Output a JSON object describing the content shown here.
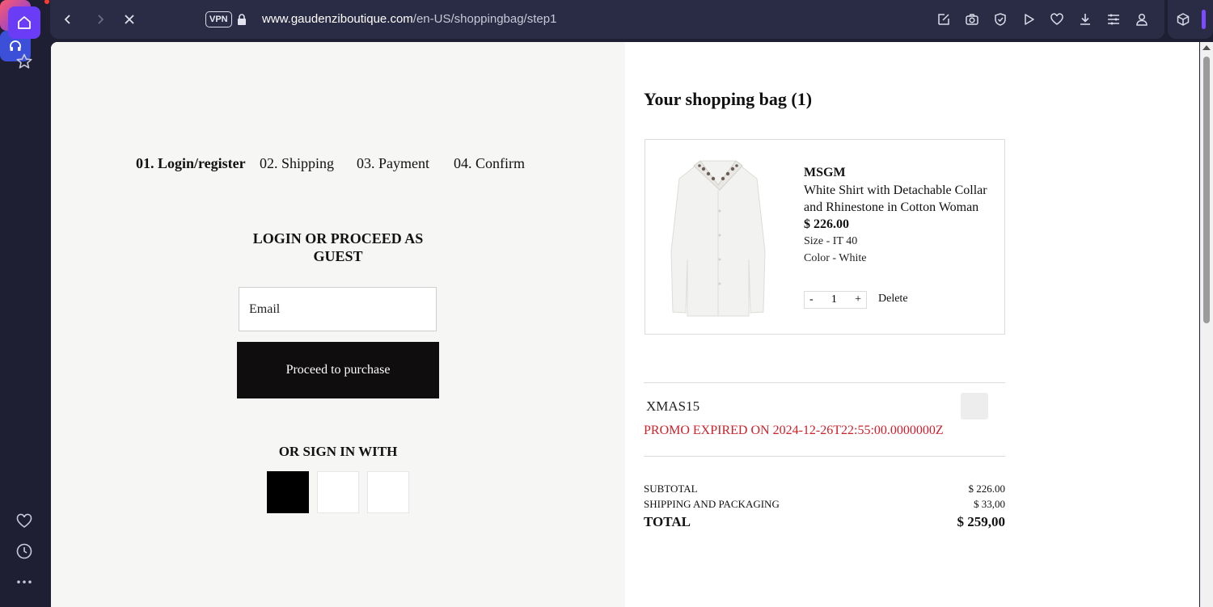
{
  "browser": {
    "vpn_label": "VPN",
    "url_host": "www.gaudenziboutique.com",
    "url_path": "/en-US/shoppingbag/step1"
  },
  "checkout": {
    "steps": [
      {
        "label": "01. Login/register",
        "active": true
      },
      {
        "label": "02. Shipping",
        "active": false
      },
      {
        "label": "03. Payment",
        "active": false
      },
      {
        "label": "04. Confirm",
        "active": false
      }
    ],
    "login_title": "LOGIN OR PROCEED AS GUEST",
    "email_placeholder": "Email",
    "proceed_label": "Proceed to purchase",
    "or_sign_in": "OR SIGN IN WITH"
  },
  "bag": {
    "title": "Your shopping bag (1)",
    "item": {
      "brand": "MSGM",
      "name": "White Shirt with Detachable Collar and Rhinestone in Cotton Woman",
      "price": "$ 226.00",
      "size": "Size - IT 40",
      "color": "Color - White",
      "qty_minus": "-",
      "qty": "1",
      "qty_plus": "+",
      "delete_label": "Delete"
    },
    "promo": {
      "code": "XMAS15",
      "message": "PROMO EXPIRED ON 2024-12-26T22:55:00.0000000Z"
    },
    "summary": {
      "subtotal_label": "SUBTOTAL",
      "subtotal_value": "$ 226.00",
      "shipping_label": "SHIPPING AND PACKAGING",
      "shipping_value": "$ 33,00",
      "total_label": "TOTAL",
      "total_value": "$ 259,00"
    }
  },
  "colors": {
    "accent": "#6b3cf5",
    "promo_error": "#d0202a",
    "button_dark": "#0f0d0d"
  }
}
